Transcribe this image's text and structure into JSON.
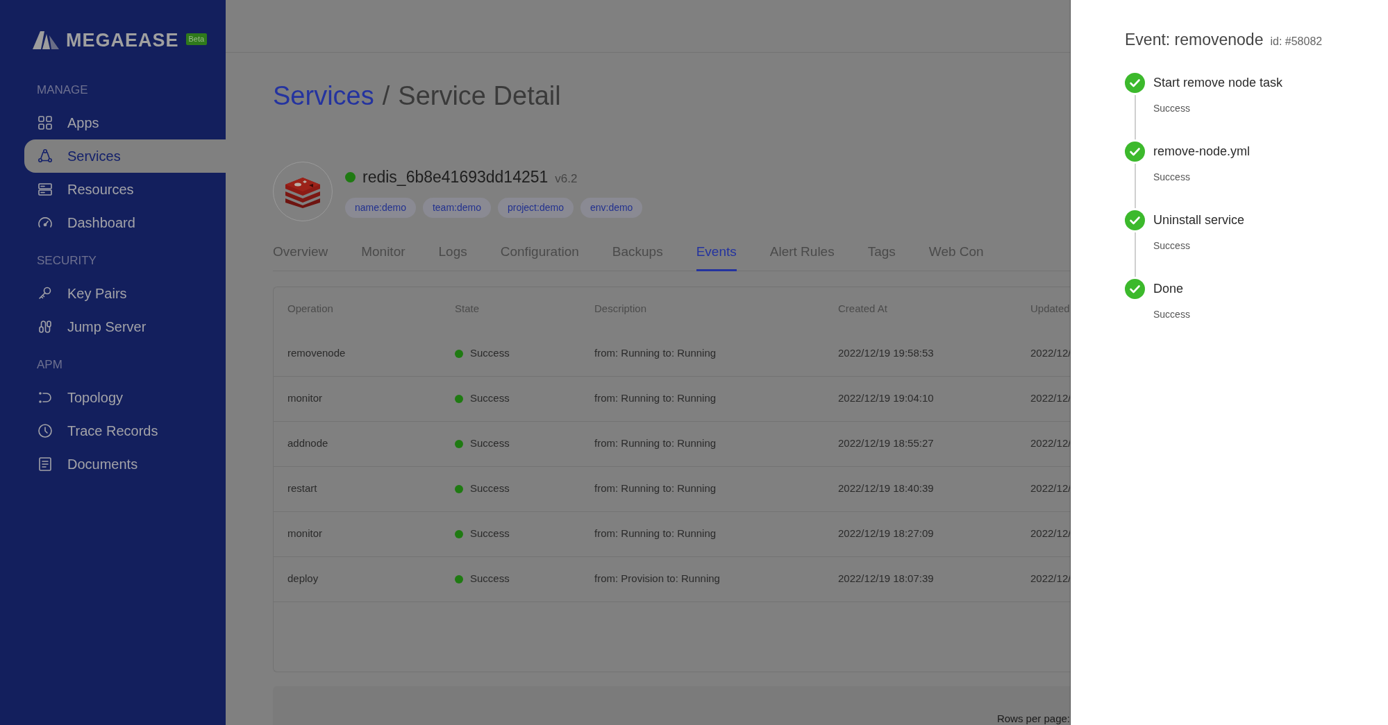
{
  "logo": {
    "text": "MEGAEASE",
    "badge": "Beta"
  },
  "sidebar": {
    "sections": [
      {
        "heading": "MANAGE",
        "items": [
          {
            "label": "Apps",
            "selected": false
          },
          {
            "label": "Services",
            "selected": true
          },
          {
            "label": "Resources",
            "selected": false
          },
          {
            "label": "Dashboard",
            "selected": false
          }
        ]
      },
      {
        "heading": "SECURITY",
        "items": [
          {
            "label": "Key Pairs",
            "selected": false
          },
          {
            "label": "Jump Server",
            "selected": false
          }
        ]
      },
      {
        "heading": "APM",
        "items": [
          {
            "label": "Topology",
            "selected": false
          },
          {
            "label": "Trace Records",
            "selected": false
          },
          {
            "label": "Documents",
            "selected": false
          }
        ]
      }
    ]
  },
  "breadcrumb": {
    "parent": "Services",
    "separator": "/",
    "current": "Service Detail"
  },
  "service": {
    "name": "redis_6b8e41693dd14251",
    "version": "v6.2",
    "tags": [
      "name:demo",
      "team:demo",
      "project:demo",
      "env:demo"
    ]
  },
  "tabs": [
    {
      "label": "Overview",
      "selected": false
    },
    {
      "label": "Monitor",
      "selected": false
    },
    {
      "label": "Logs",
      "selected": false
    },
    {
      "label": "Configuration",
      "selected": false
    },
    {
      "label": "Backups",
      "selected": false
    },
    {
      "label": "Events",
      "selected": true
    },
    {
      "label": "Alert Rules",
      "selected": false
    },
    {
      "label": "Tags",
      "selected": false
    },
    {
      "label": "Web Con",
      "selected": false
    }
  ],
  "table": {
    "columns": [
      "Operation",
      "State",
      "Description",
      "Created At",
      "Updated"
    ],
    "rows": [
      [
        "removenode",
        "Success",
        "from: Running to: Running",
        "2022/12/19 19:58:53",
        "2022/12/"
      ],
      [
        "monitor",
        "Success",
        "from: Running to: Running",
        "2022/12/19 19:04:10",
        "2022/12/"
      ],
      [
        "addnode",
        "Success",
        "from: Running to: Running",
        "2022/12/19 18:55:27",
        "2022/12/"
      ],
      [
        "restart",
        "Success",
        "from: Running to: Running",
        "2022/12/19 18:40:39",
        "2022/12/"
      ],
      [
        "monitor",
        "Success",
        "from: Running to: Running",
        "2022/12/19 18:27:09",
        "2022/12/"
      ],
      [
        "deploy",
        "Success",
        "from: Provision to: Running",
        "2022/12/19 18:07:39",
        "2022/12/"
      ]
    ]
  },
  "pagination": {
    "rows_per_page_label": "Rows per page:"
  },
  "event_panel": {
    "title": "Event: removenode",
    "id": "id: #58082",
    "steps": [
      {
        "title": "Start remove node task",
        "status": "Success"
      },
      {
        "title": "remove-node.yml",
        "status": "Success"
      },
      {
        "title": "Uninstall service",
        "status": "Success"
      },
      {
        "title": "Done",
        "status": "Success"
      }
    ]
  }
}
